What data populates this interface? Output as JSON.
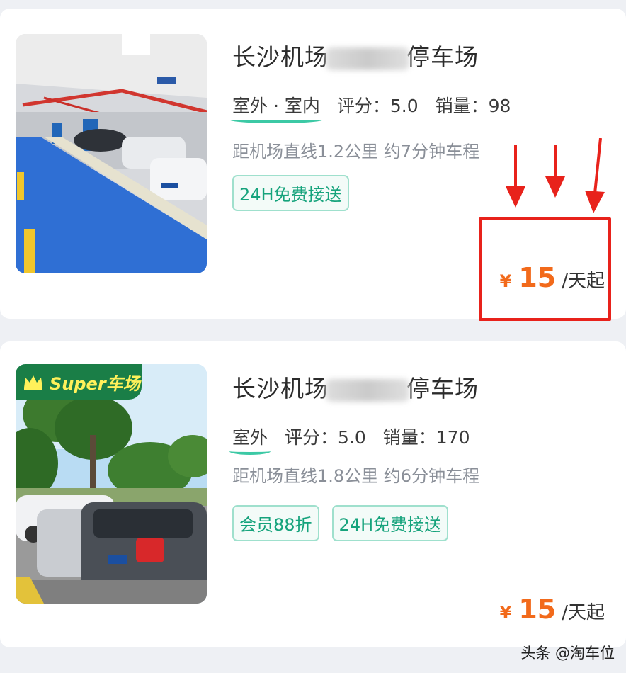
{
  "listings": [
    {
      "title_prefix": "长沙机场",
      "title_suffix": "停车场",
      "location_type": "室外 · 室内",
      "rating_text": "评分：5.0",
      "sales_text": "销量：98",
      "distance": "距机场直线1.2公里 约7分钟车程",
      "tags": [
        "24H免费接送"
      ],
      "currency": "¥",
      "price": "15",
      "price_unit": "/天起",
      "badge": ""
    },
    {
      "title_prefix": "长沙机场",
      "title_suffix": "停车场",
      "location_type": "室外",
      "rating_text": "评分：5.0",
      "sales_text": "销量：170",
      "distance": "距机场直线1.8公里 约6分钟车程",
      "tags": [
        "会员88折",
        "24H免费接送"
      ],
      "currency": "¥",
      "price": "15",
      "price_unit": "/天起",
      "badge": "Super车场"
    }
  ],
  "colors": {
    "price": "#f26a1b",
    "tag_text": "#16a37c",
    "highlight": "#e8221b",
    "badge_bg": "#1a7e47",
    "badge_text": "#fff15a"
  },
  "watermark": "头条 @淘车位"
}
